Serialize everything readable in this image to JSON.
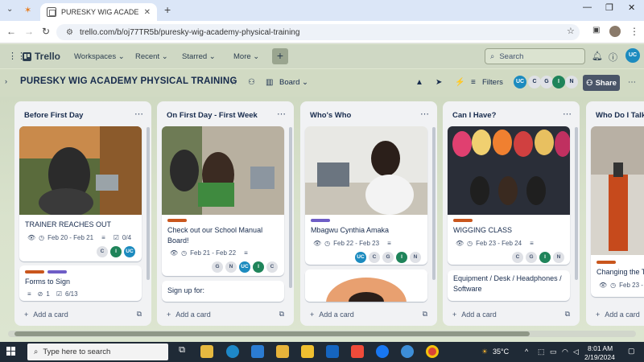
{
  "browser": {
    "tab_title": "PURESKY WIG ACADEMY PHYSI",
    "url": "trello.com/b/oj77TR5b/puresky-wig-academy-physical-training",
    "new_tab": "+"
  },
  "trello": {
    "logo": "Trello",
    "menus": [
      "Workspaces",
      "Recent",
      "Starred",
      "More"
    ],
    "search_placeholder": "Search",
    "user_initials": "UC"
  },
  "board": {
    "title": "PURESKY WIG ACADEMY PHYSICAL TRAINING",
    "view": "Board",
    "filters": "Filters",
    "share": "Share",
    "members": [
      "UC",
      "C",
      "G",
      "I",
      "N"
    ]
  },
  "lists": [
    {
      "title": "Before First Day",
      "cards": [
        {
          "title": "TRAINER REACHES OUT",
          "dates": "Feb 20 - Feb 21",
          "checklist": "0/4",
          "members": [
            "C",
            "I",
            "UC"
          ]
        },
        {
          "title": "Forms to Sign",
          "attachments": "1",
          "checklist": "6/13"
        }
      ],
      "add_card": "Add a card"
    },
    {
      "title": "On First Day - First Week",
      "cards": [
        {
          "title": "Check out our School Manual Board!",
          "dates": "Feb 21 - Feb 22",
          "members": [
            "G",
            "N",
            "UC",
            "I",
            "C"
          ]
        },
        {
          "title": "Sign up for:"
        }
      ],
      "add_card": "Add a card"
    },
    {
      "title": "Who's Who",
      "cards": [
        {
          "title": "Mbagwu Cynthia Amaka",
          "dates": "Feb 22 - Feb 23",
          "members": [
            "UC",
            "C",
            "G",
            "I",
            "N"
          ]
        }
      ],
      "add_card": "Add a card"
    },
    {
      "title": "Can I Have?",
      "cards": [
        {
          "title": "WIGGING CLASS",
          "dates": "Feb 23 - Feb 24",
          "members": [
            "C",
            "G",
            "I",
            "N"
          ]
        },
        {
          "title": "Equipment / Desk / Headphones / Software"
        }
      ],
      "add_card": "Add a card"
    },
    {
      "title": "Who Do I Talk to?",
      "cards": [
        {
          "title": "Changing the T",
          "dates": "Feb 23 -"
        }
      ],
      "add_card": "Add a card"
    }
  ],
  "taskbar": {
    "search_placeholder": "Type here to search",
    "temperature": "35°C",
    "time": "8:01 AM",
    "date": "2/19/2024"
  },
  "colors": {
    "label_orange": "#c9561d",
    "label_purple": "#6e5dc6",
    "member_green": "#1f845a",
    "member_blue": "#1c8bbf"
  }
}
